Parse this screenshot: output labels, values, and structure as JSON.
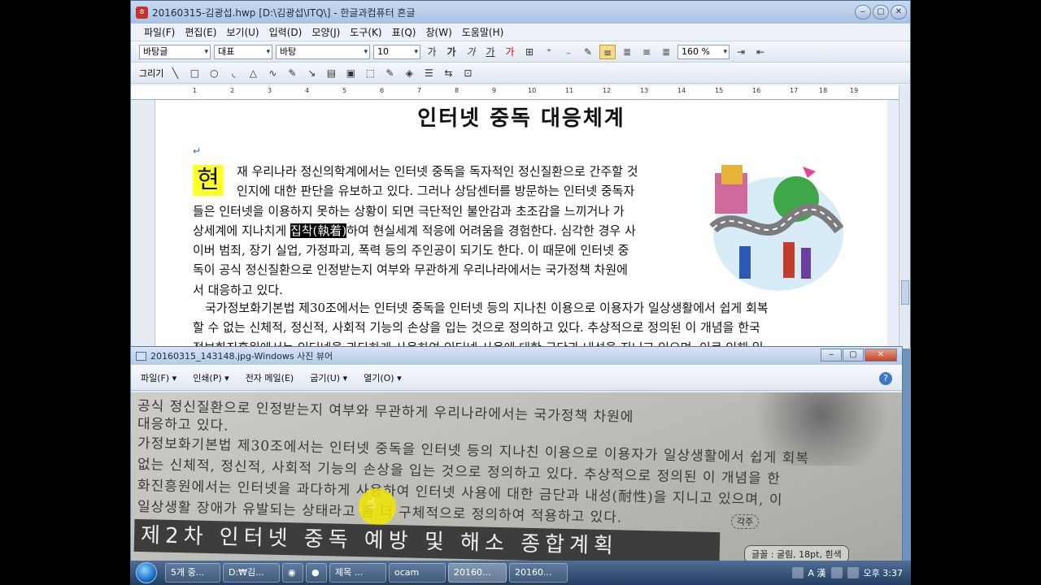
{
  "hwp": {
    "title": "20160315-김광섭.hwp [D:\\김광섭\\ITQ\\] - 한글과컴퓨터 흔글",
    "menu": [
      "파일(F)",
      "편집(E)",
      "보기(U)",
      "입력(D)",
      "모양(J)",
      "도구(K)",
      "표(Q)",
      "창(W)",
      "도움말(H)"
    ],
    "toolbar": {
      "style": "바탕글",
      "font_type": "대표",
      "font": "바탕",
      "size": "10",
      "zoom": "160 %",
      "draw_label": "그리기"
    },
    "ruler_numbers": [
      "1",
      "2",
      "3",
      "4",
      "5",
      "6",
      "7",
      "8",
      "9",
      "10",
      "11",
      "12",
      "13",
      "14",
      "15",
      "16",
      "17",
      "18",
      "19"
    ],
    "doc": {
      "title": "인터넷 중독 대응체계",
      "dropcap": "현",
      "p1_lines": [
        "재 우리나라 정신의학계에서는 인터넷 중독을 독자적인 정신질환으로 간주할 것",
        "인지에 대한 판단을 유보하고 있다. 그러나 상담센터를 방문하는 인터넷 중독자",
        "들은 인터넷을 이용하지 못하는 상황이 되면 극단적인 불안감과 초조감을 느끼거나 가",
        "상세계에 지나치게 ",
        "집착(執着)",
        "하여 현실세계 적응에 어려움을 경험한다. 심각한 경우 사",
        "이버 범죄, 장기 실업, 가정파괴, 폭력 등의 주인공이 되기도 한다. 이 때문에 인터넷 중",
        "독이 공식 정신질환으로 인정받는지 여부와 무관하게 우리나라에서는 국가정책 차원에",
        "서 대응하고 있다."
      ],
      "p2_lines": [
        "국가정보화기본법 제30조에서는 인터넷 중독을 인터넷 등의 지나친 이용으로 이용자가 일상생활에서 쉽게 회복",
        "할 수 없는 신체적, 정신적, 사회적 기능의 손상을 입는 것으로 정의하고 있다. 추상적으로 정의된 이 개념을 한국",
        "정보화진흥원에서는 인터넷을 과다하게 사용하여 인터넷 사용에 대한 금단과 내성을 지니고 있으며, 이로 인해 일"
      ]
    }
  },
  "viewer": {
    "title": "20160315_143148.jpg-Windows 사진 뷰어",
    "menu": [
      "파일(F)",
      "인쇄(P)",
      "전자 메일(E)",
      "굽기(U)",
      "열기(O)"
    ],
    "photo_lines": [
      "공식 정신질환으로 인정받는지 여부와 무관하게 우리나라에서는 국가정책 차원에",
      "대응하고 있다.",
      "가정보화기본법 제30조에서는 인터넷 중독을 인터넷 등의 지나친 이용으로 이용자가 일상생활에서 쉽게 회복",
      "없는 신체적, 정신적, 사회적 기능의 손상을 입는 것으로 정의하고 있다. 추상적으로 정의된 이 개념을 한",
      "화진흥원에서는 인터넷을 과다하게 사용하여 인터넷 사용에 대한 금단과 내성(耐性)을 지니고 있으며, 이",
      "일상생활 장애가 유발되는 상태라고 좀 더 구체적으로 정의하여 적용하고 있다."
    ],
    "photo_banner": "제2차 인터넷 중독 예방 및 해소 종합계획",
    "photo_tag": "각주",
    "photo_tag2": "글꼴 : 굴림, 18pt, 흰색"
  },
  "taskbar": {
    "tasks": [
      "5개 중...",
      "D:₩김...",
      "제목 ...",
      "ocam",
      "20160...",
      "20160..."
    ],
    "ime": "A 漢",
    "clock": "오후 3:37"
  }
}
